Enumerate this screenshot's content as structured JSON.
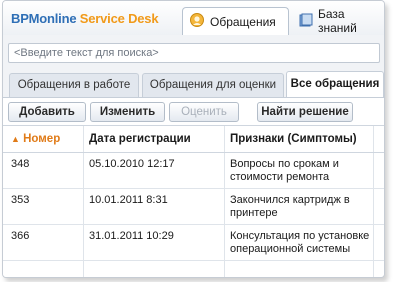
{
  "app": {
    "brand_part1": "BPMonline",
    "brand_part2": "Service Desk"
  },
  "tabs": [
    {
      "label": "Обращения",
      "icon": "support-agent-icon",
      "active": true
    },
    {
      "label": "База знаний",
      "icon": "knowledge-base-icon",
      "active": false
    }
  ],
  "search": {
    "placeholder": "<Введите текст для поиска>"
  },
  "subtabs": [
    {
      "label": "Обращения в работе"
    },
    {
      "label": "Обращения для оценки"
    },
    {
      "label": "Все обращения"
    }
  ],
  "toolbar": {
    "add": "Добавить",
    "edit": "Изменить",
    "rate": "Оценить",
    "find": "Найти решение"
  },
  "table": {
    "columns": [
      "Номер",
      "Дата регистрации",
      "Признаки (Симптомы)"
    ],
    "sort_indicator": "▲",
    "rows": [
      {
        "num": "348",
        "date": "05.10.2010 12:17",
        "sign1": "Вопросы по срокам и",
        "sign2": "стоимости ремонта"
      },
      {
        "num": "353",
        "date": "10.01.2011 8:31",
        "sign1": "Закончился картридж в",
        "sign2": "принтере"
      },
      {
        "num": "366",
        "date": "31.01.2011 10:29",
        "sign1": "Консультация по установке",
        "sign2": "операционной системы"
      }
    ]
  },
  "colors": {
    "brand_blue": "#2f6fb6",
    "brand_orange": "#f19a1a",
    "sort_orange": "#e07b18"
  }
}
